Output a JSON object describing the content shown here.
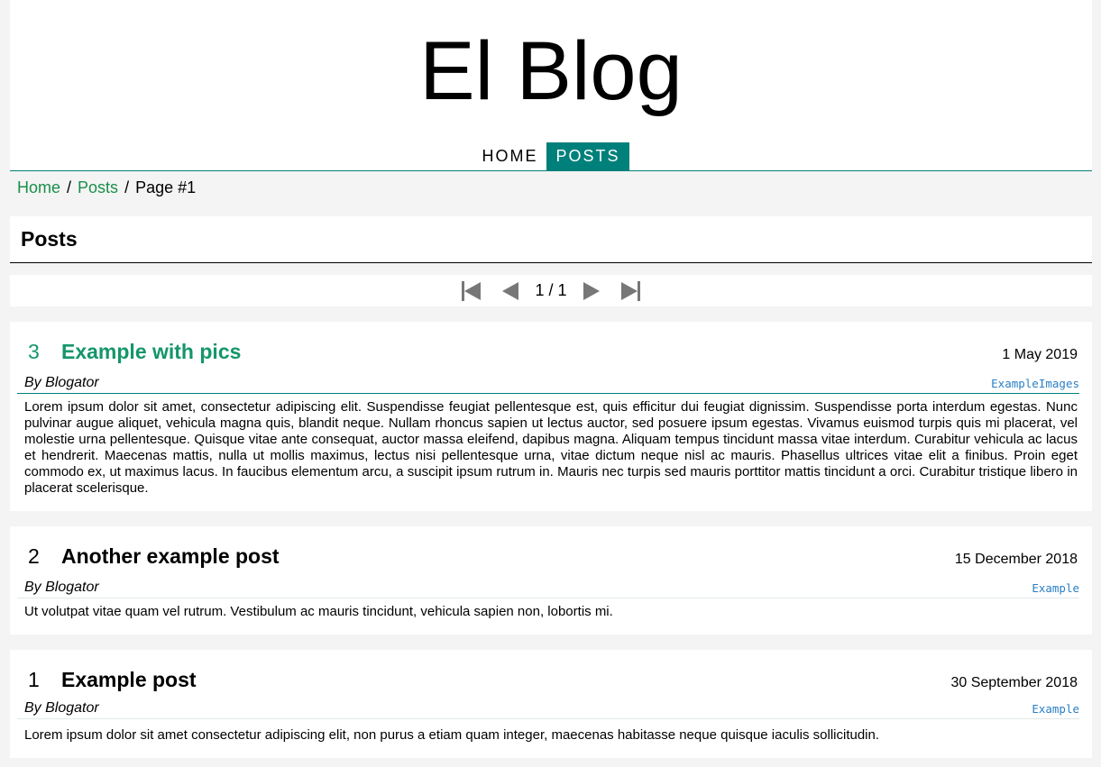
{
  "site": {
    "title": "El Blog"
  },
  "nav": {
    "items": [
      {
        "label": "HOME"
      },
      {
        "label": "POSTS"
      }
    ],
    "active": "POSTS"
  },
  "breadcrumb": {
    "items": [
      {
        "label": "Home"
      },
      {
        "label": "Posts"
      },
      {
        "label": "Page #1"
      }
    ],
    "separator": "/"
  },
  "section": {
    "title": "Posts"
  },
  "pager": {
    "current": 1,
    "total": 1,
    "label": "1 / 1"
  },
  "colors": {
    "accent": "#00807a",
    "link_green": "#1a8f4a",
    "highlight_title": "#14966b",
    "tag_blue": "#2a7fc6"
  },
  "posts": [
    {
      "number": "3",
      "title": "Example with pics",
      "date": "1 May 2019",
      "author": "By Blogator",
      "tag": "ExampleImages",
      "body": "Lorem ipsum dolor sit amet, consectetur adipiscing elit. Suspendisse feugiat pellentesque est, quis efficitur dui feugiat dignissim. Suspendisse porta interdum egestas. Nunc pulvinar augue aliquet, vehicula magna quis, blandit neque. Nullam rhoncus sapien ut lectus auctor, sed posuere ipsum egestas. Vivamus euismod turpis quis mi placerat, vel molestie urna pellentesque. Quisque vitae ante consequat, auctor massa eleifend, dapibus magna. Aliquam tempus tincidunt massa vitae interdum. Curabitur vehicula ac lacus et hendrerit. Maecenas mattis, nulla ut mollis maximus, lectus nisi pellentesque urna, vitae dictum neque nisl ac mauris. Phasellus ultrices vitae elit a finibus. Proin eget commodo ex, ut maximus lacus. In faucibus elementum arcu, a suscipit ipsum rutrum in. Mauris nec turpis sed mauris porttitor mattis tincidunt a orci. Curabitur tristique libero in placerat scelerisque."
    },
    {
      "number": "2",
      "title": "Another example post",
      "date": "15 December 2018",
      "author": "By Blogator",
      "tag": "Example",
      "body": "Ut volutpat vitae quam vel rutrum. Vestibulum ac mauris tincidunt, vehicula sapien non, lobortis mi."
    },
    {
      "number": "1",
      "title": "Example post",
      "date": "30 September 2018",
      "author": "By Blogator",
      "tag": "Example",
      "body": "Lorem ipsum dolor sit amet consectetur adipiscing elit, non purus a etiam quam integer, maecenas habitasse neque quisque iaculis sollicitudin."
    }
  ]
}
